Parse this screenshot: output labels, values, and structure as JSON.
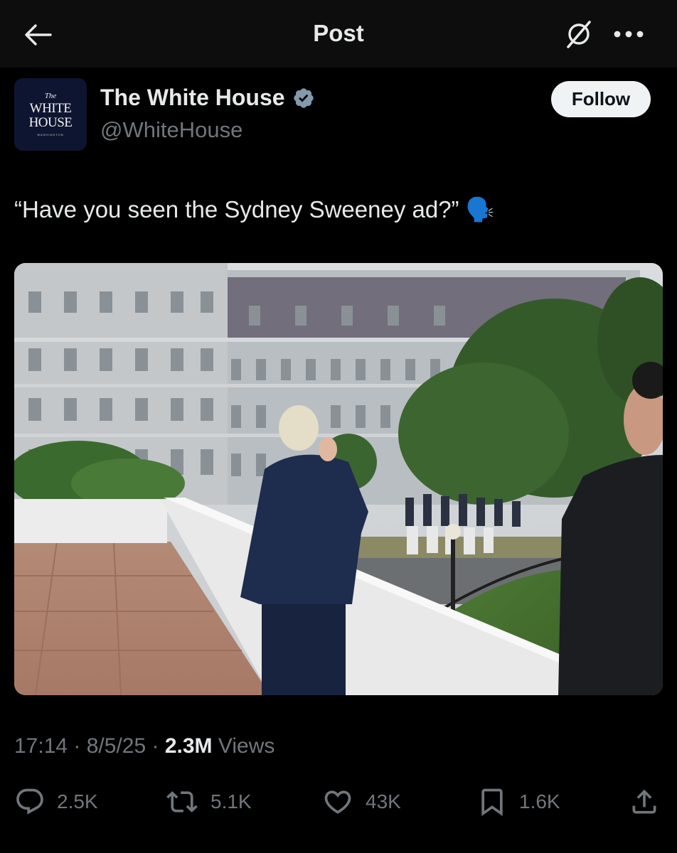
{
  "topbar": {
    "title": "Post",
    "back_icon": "arrow-left-icon",
    "grok_icon": "grok-icon",
    "more_icon": "more-horizontal-icon"
  },
  "author": {
    "avatar_the": "The",
    "avatar_line1": "WHITE",
    "avatar_line2": "HOUSE",
    "avatar_sub": "WASHINGTON",
    "display_name": "The White House",
    "handle": "@WhiteHouse",
    "verified_color": "#829aab",
    "follow_label": "Follow"
  },
  "post": {
    "text": "“Have you seen the Sydney Sweeney ad?” 🗣️",
    "photo_description_icon": "photo-image"
  },
  "meta": {
    "time": "17:14",
    "sep1": " · ",
    "date": "8/5/25",
    "sep2": " · ",
    "views_count": "2.3M",
    "views_label": " Views"
  },
  "actions": {
    "replies": "2.5K",
    "reposts": "5.1K",
    "likes": "43K",
    "bookmarks": "1.6K"
  },
  "colors": {
    "background": "#000000",
    "topbar": "#0d0d0d",
    "primary_text": "#e7e9ea",
    "secondary_text": "#71767b",
    "follow_bg": "#eff3f4",
    "avatar_bg": "#0e1530"
  }
}
